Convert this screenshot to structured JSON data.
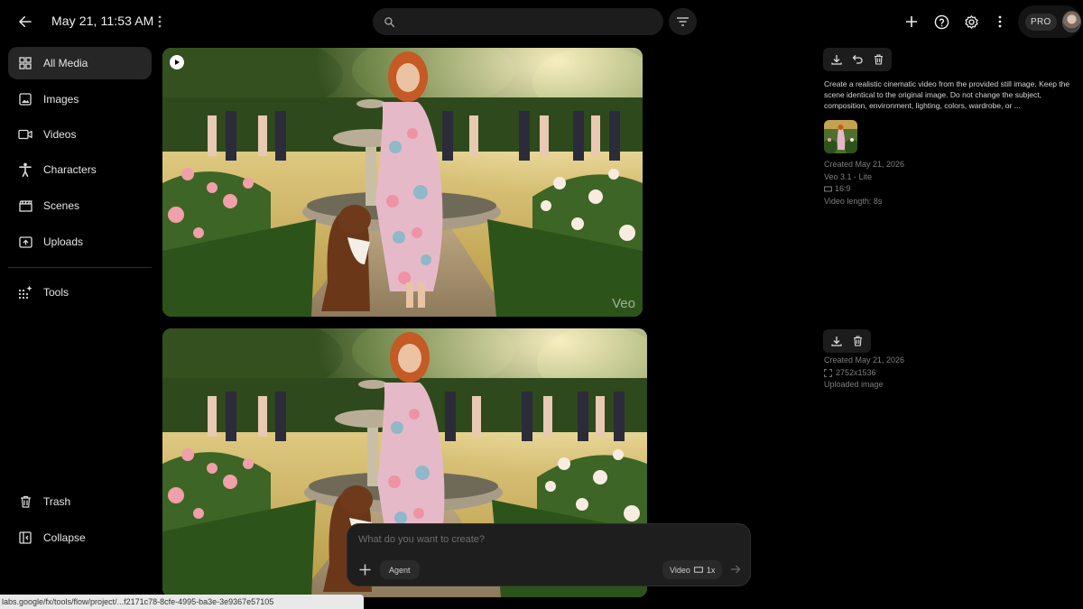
{
  "header": {
    "title": "May 21, 11:53 AM",
    "search_placeholder": "",
    "pro_label": "PRO"
  },
  "sidebar": {
    "items": [
      {
        "label": "All Media",
        "icon": "grid-icon"
      },
      {
        "label": "Images",
        "icon": "image-icon"
      },
      {
        "label": "Videos",
        "icon": "video-icon"
      },
      {
        "label": "Characters",
        "icon": "person-icon"
      },
      {
        "label": "Scenes",
        "icon": "clapperboard-icon"
      },
      {
        "label": "Uploads",
        "icon": "upload-icon"
      },
      {
        "label": "Tools",
        "icon": "sparkle-grid-icon"
      },
      {
        "label": "Trash",
        "icon": "trash-icon"
      },
      {
        "label": "Collapse",
        "icon": "collapse-icon"
      }
    ]
  },
  "media": [
    {
      "type": "video",
      "watermark": "Veo",
      "prompt": "Create a realistic cinematic video from the provided still image. Keep the scene identical to the original image. Do not change the subject, composition, environment, lighting, colors, wardrobe, or ...",
      "created": "Created May 21, 2026",
      "model": "Veo 3.1 - Lite",
      "aspect": "16:9",
      "length": "Video length: 8s"
    },
    {
      "type": "image",
      "created": "Created May 21, 2026",
      "dimensions": "2752x1536",
      "source": "Uploaded image"
    }
  ],
  "composer": {
    "placeholder": "What do you want to create?",
    "agent_label": "Agent",
    "mode_label": "Video",
    "count_label": "1x"
  },
  "status_url": "labs.google/fx/tools/flow/project/...f2171c78-8cfe-4995-ba3e-3e9367e57105",
  "colors": {
    "background": "#000000",
    "active_nav": "#262626",
    "panel": "#1c1c1c",
    "muted_text": "#7e7e7e"
  }
}
